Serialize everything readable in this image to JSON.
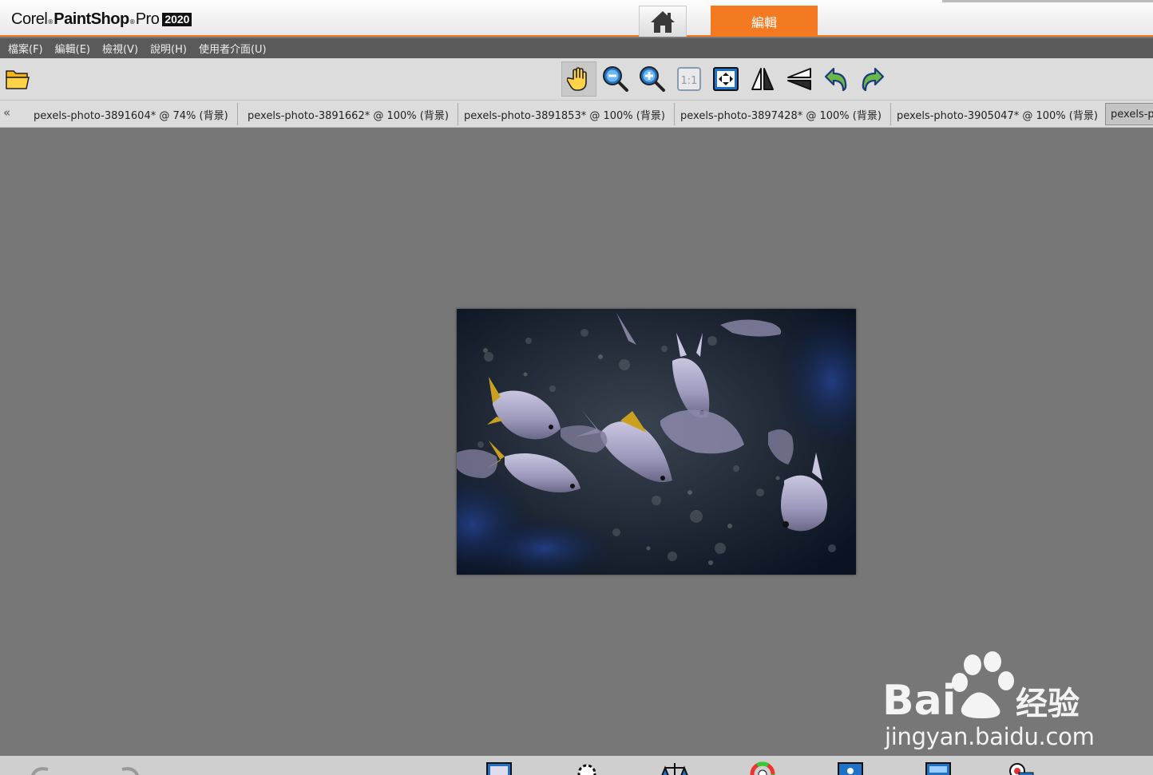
{
  "app": {
    "brand_corel": "Corel",
    "brand_paintshop": "PaintShop",
    "brand_pro": "Pro",
    "brand_year": "2020",
    "edit_tab_label": "編輯",
    "accent_color": "#f37a21"
  },
  "menu": [
    {
      "label": "檔案(F)"
    },
    {
      "label": "編輯(E)"
    },
    {
      "label": "檢視(V)"
    },
    {
      "label": "說明(H)"
    },
    {
      "label": "使用者介面(U)"
    }
  ],
  "toolbar": {
    "open_icon": "folder-open-icon",
    "tools": [
      {
        "name": "pan-hand-icon",
        "active": true
      },
      {
        "name": "zoom-out-icon"
      },
      {
        "name": "zoom-in-icon"
      },
      {
        "name": "actual-size-icon",
        "text": "1:1"
      },
      {
        "name": "fit-to-window-icon"
      },
      {
        "name": "flip-horizontal-icon"
      },
      {
        "name": "flip-vertical-icon"
      },
      {
        "name": "undo-icon"
      },
      {
        "name": "redo-icon"
      }
    ]
  },
  "tabs": [
    {
      "label": "pexels-photo-3891604* @  74% (背景)"
    },
    {
      "label": "pexels-photo-3891662* @ 100% (背景)"
    },
    {
      "label": "pexels-photo-3891853* @ 100% (背景)"
    },
    {
      "label": "pexels-photo-3897428* @ 100% (背景)"
    },
    {
      "label": "pexels-photo-3905047* @ 100% (背景)"
    },
    {
      "label": "pexels-pl",
      "selected": true
    }
  ],
  "watermark": {
    "brand": "Bai",
    "brand_cn": "经验",
    "domain": "jingyan.baidu.com"
  }
}
